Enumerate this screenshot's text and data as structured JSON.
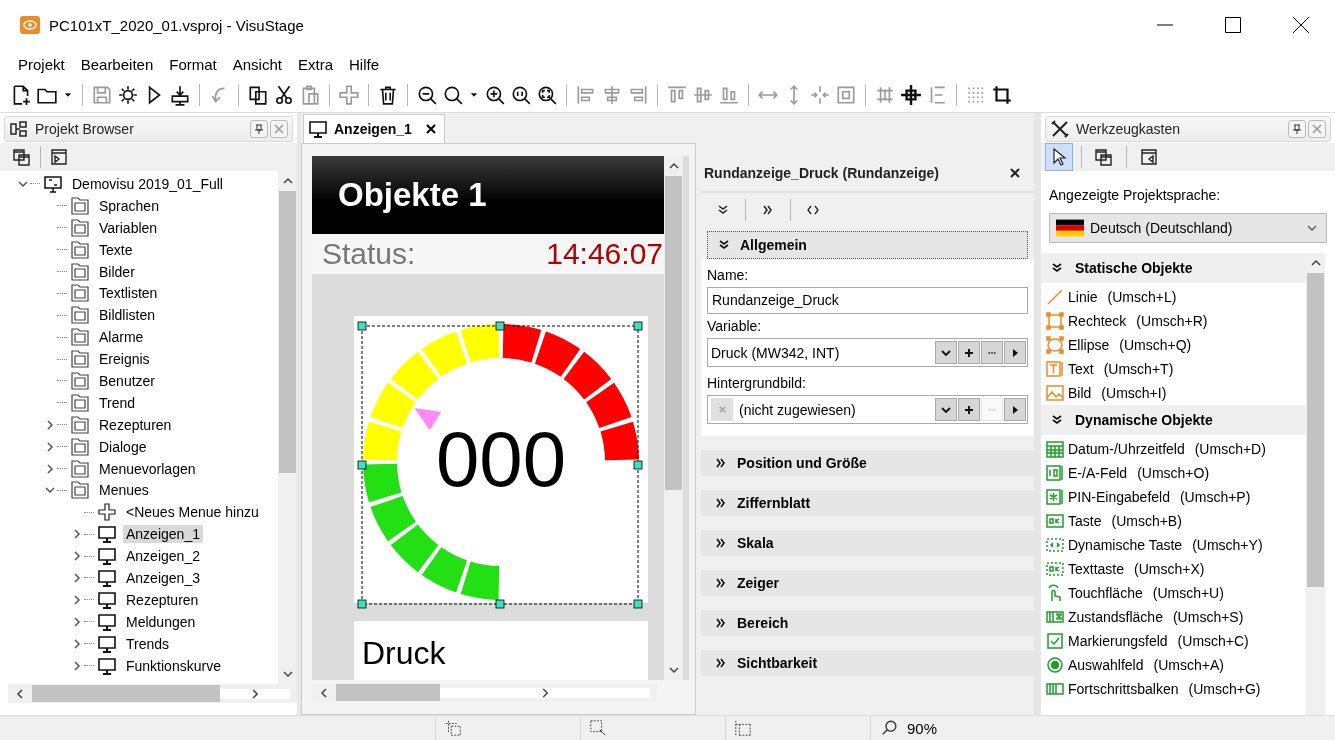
{
  "window": {
    "title": "PC101xT_2020_01.vsproj - VisuStage"
  },
  "menu": [
    "Projekt",
    "Bearbeiten",
    "Format",
    "Ansicht",
    "Extra",
    "Hilfe"
  ],
  "toolbar": [
    [
      {
        "kind": "file-plus",
        "disabled": false
      },
      {
        "kind": "folder",
        "disabled": false
      },
      {
        "kind": "caret-down",
        "disabled": false
      }
    ],
    [
      {
        "kind": "floppy-disk",
        "disabled": true
      },
      {
        "kind": "gear",
        "disabled": false
      },
      {
        "kind": "play",
        "disabled": false
      },
      {
        "kind": "download",
        "disabled": false
      }
    ],
    [
      {
        "kind": "curved-arrow",
        "disabled": true
      }
    ],
    [
      {
        "kind": "pages",
        "disabled": false
      },
      {
        "kind": "scissors",
        "disabled": false
      },
      {
        "kind": "clipboard",
        "disabled": true
      }
    ],
    [
      {
        "kind": "plus",
        "disabled": true
      }
    ],
    [
      {
        "kind": "trash",
        "disabled": false
      }
    ],
    [
      {
        "kind": "zoom-out",
        "disabled": false
      },
      {
        "kind": "magnifier",
        "disabled": false
      },
      {
        "kind": "caret-down",
        "disabled": false
      },
      {
        "kind": "zoom-in",
        "disabled": false
      },
      {
        "kind": "zoom-actual",
        "disabled": false
      },
      {
        "kind": "zoom-fit",
        "disabled": false
      }
    ],
    [
      {
        "kind": "align-left",
        "disabled": true
      },
      {
        "kind": "align-center",
        "disabled": true
      },
      {
        "kind": "align-right",
        "disabled": true
      }
    ],
    [
      {
        "kind": "align-top",
        "disabled": true
      },
      {
        "kind": "align-middle",
        "disabled": true
      },
      {
        "kind": "align-bottom",
        "disabled": true
      }
    ],
    [
      {
        "kind": "width-arrows",
        "disabled": true
      },
      {
        "kind": "height-arrows",
        "disabled": true
      },
      {
        "kind": "shrink-arrows",
        "disabled": true
      },
      {
        "kind": "resize-frame",
        "disabled": true
      }
    ],
    [
      {
        "kind": "spacing-horizontal",
        "disabled": true
      },
      {
        "kind": "crosshair",
        "disabled": false
      },
      {
        "kind": "spacing-vertical",
        "disabled": true
      }
    ],
    [
      {
        "kind": "dot-grid",
        "disabled": true
      },
      {
        "kind": "crop",
        "disabled": false
      }
    ]
  ],
  "project_browser": {
    "title": "Projekt Browser",
    "tree": [
      {
        "label": "Demovisu 2019_01_Full",
        "kind": "project",
        "expanded": true,
        "selected": false,
        "children": [
          {
            "label": "Sprachen",
            "kind": "folder",
            "selected": false
          },
          {
            "label": "Variablen",
            "kind": "folder",
            "selected": false
          },
          {
            "label": "Texte",
            "kind": "folder",
            "selected": false
          },
          {
            "label": "Bilder",
            "kind": "folder",
            "selected": false
          },
          {
            "label": "Textlisten",
            "kind": "folder",
            "selected": false
          },
          {
            "label": "Bildlisten",
            "kind": "folder",
            "selected": false
          },
          {
            "label": "Alarme",
            "kind": "folder",
            "selected": false
          },
          {
            "label": "Ereignis",
            "kind": "folder",
            "selected": false
          },
          {
            "label": "Benutzer",
            "kind": "folder",
            "selected": false
          },
          {
            "label": "Trend",
            "kind": "folder",
            "selected": false
          },
          {
            "label": "Rezepturen",
            "kind": "folder",
            "expanded": false,
            "selected": false
          },
          {
            "label": "Dialoge",
            "kind": "folder",
            "expanded": false,
            "selected": false
          },
          {
            "label": "Menuevorlagen",
            "kind": "folder",
            "expanded": false,
            "selected": false
          },
          {
            "label": "Menues",
            "kind": "folder",
            "expanded": true,
            "selected": false,
            "children": [
              {
                "label": "<Neues Menue hinzu",
                "kind": "add",
                "selected": false
              },
              {
                "label": "Anzeigen_1",
                "kind": "screen",
                "expanded": false,
                "selected": true
              },
              {
                "label": "Anzeigen_2",
                "kind": "screen",
                "expanded": false,
                "selected": false
              },
              {
                "label": "Anzeigen_3",
                "kind": "screen",
                "expanded": false,
                "selected": false
              },
              {
                "label": "Rezepturen",
                "kind": "screen",
                "expanded": false,
                "selected": false
              },
              {
                "label": "Meldungen",
                "kind": "screen",
                "expanded": false,
                "selected": false
              },
              {
                "label": "Trends",
                "kind": "screen",
                "expanded": false,
                "selected": false
              },
              {
                "label": "Funktionskurve",
                "kind": "screen",
                "expanded": false,
                "selected": false
              }
            ]
          }
        ]
      }
    ]
  },
  "editor": {
    "tab": "Anzeigen_1",
    "screen": {
      "header": "Objekte 1",
      "status_label": "Status:",
      "time": "14:46:07",
      "gauge_value": "000",
      "caption": "Druck"
    }
  },
  "properties": {
    "title": "Rundanzeige_Druck (Rundanzeige)",
    "sections": [
      {
        "title": "Allgemein",
        "expanded": true,
        "fields": [
          {
            "kind": "text",
            "label": "Name:",
            "value": "Rundanzeige_Druck"
          },
          {
            "kind": "picker",
            "label": "Variable:",
            "value": "Druck (MW342, INT)",
            "clear_icon": false,
            "more_disabled": false
          },
          {
            "kind": "picker",
            "label": "Hintergrundbild:",
            "value": "(nicht zugewiesen)",
            "clear_icon": true,
            "more_disabled": true
          }
        ]
      },
      {
        "title": "Position und Größe",
        "expanded": false
      },
      {
        "title": "Ziffernblatt",
        "expanded": false
      },
      {
        "title": "Skala",
        "expanded": false
      },
      {
        "title": "Zeiger",
        "expanded": false
      },
      {
        "title": "Bereich",
        "expanded": false
      },
      {
        "title": "Sichtbarkeit",
        "expanded": false
      }
    ]
  },
  "toolbox": {
    "title": "Werkzeugkasten",
    "tools": [
      {
        "kind": "pointer",
        "selected": true
      },
      {
        "kind": "windows",
        "selected": false
      },
      {
        "kind": "window-arrow",
        "selected": false
      }
    ],
    "language_label": "Angezeigte Projektsprache:",
    "language": "Deutsch (Deutschland)",
    "sections": [
      {
        "title": "Statische Objekte",
        "expanded": true,
        "color": "#f08a24",
        "items": [
          {
            "kind": "line",
            "label": "Linie",
            "shortcut": "(Umsch+L)"
          },
          {
            "kind": "rectangle",
            "label": "Rechteck",
            "shortcut": "(Umsch+R)"
          },
          {
            "kind": "ellipse",
            "label": "Ellipse",
            "shortcut": "(Umsch+Q)"
          },
          {
            "kind": "text",
            "label": "Text",
            "shortcut": "(Umsch+T)"
          },
          {
            "kind": "picture",
            "label": "Bild",
            "shortcut": "(Umsch+I)"
          }
        ]
      },
      {
        "title": "Dynamische Objekte",
        "expanded": true,
        "color": "#1e9e2a",
        "items": [
          {
            "kind": "calendar",
            "label": "Datum-/Uhrzeitfeld",
            "shortcut": "(Umsch+D)"
          },
          {
            "kind": "number-field",
            "label": "E-/A-Feld",
            "shortcut": "(Umsch+O)"
          },
          {
            "kind": "asterisk",
            "label": "PIN-Eingabefeld",
            "shortcut": "(Umsch+P)"
          },
          {
            "kind": "ok-button",
            "label": "Taste",
            "shortcut": "(Umsch+B)"
          },
          {
            "kind": "dashed-button",
            "label": "Dynamische Taste",
            "shortcut": "(Umsch+Y)"
          },
          {
            "kind": "dashed-ok",
            "label": "Texttaste",
            "shortcut": "(Umsch+X)"
          },
          {
            "kind": "hand",
            "label": "Touchfläche",
            "shortcut": "(Umsch+U)"
          },
          {
            "kind": "striped-bar",
            "label": "Zustandsfläche",
            "shortcut": "(Umsch+S)"
          },
          {
            "kind": "checkbox",
            "label": "Markierungsfeld",
            "shortcut": "(Umsch+C)"
          },
          {
            "kind": "radio",
            "label": "Auswahlfeld",
            "shortcut": "(Umsch+A)"
          },
          {
            "kind": "progress-bar",
            "label": "Fortschrittsbalken",
            "shortcut": "(Umsch+G)"
          }
        ]
      }
    ]
  },
  "status_bar": {
    "zoom": "90%"
  }
}
